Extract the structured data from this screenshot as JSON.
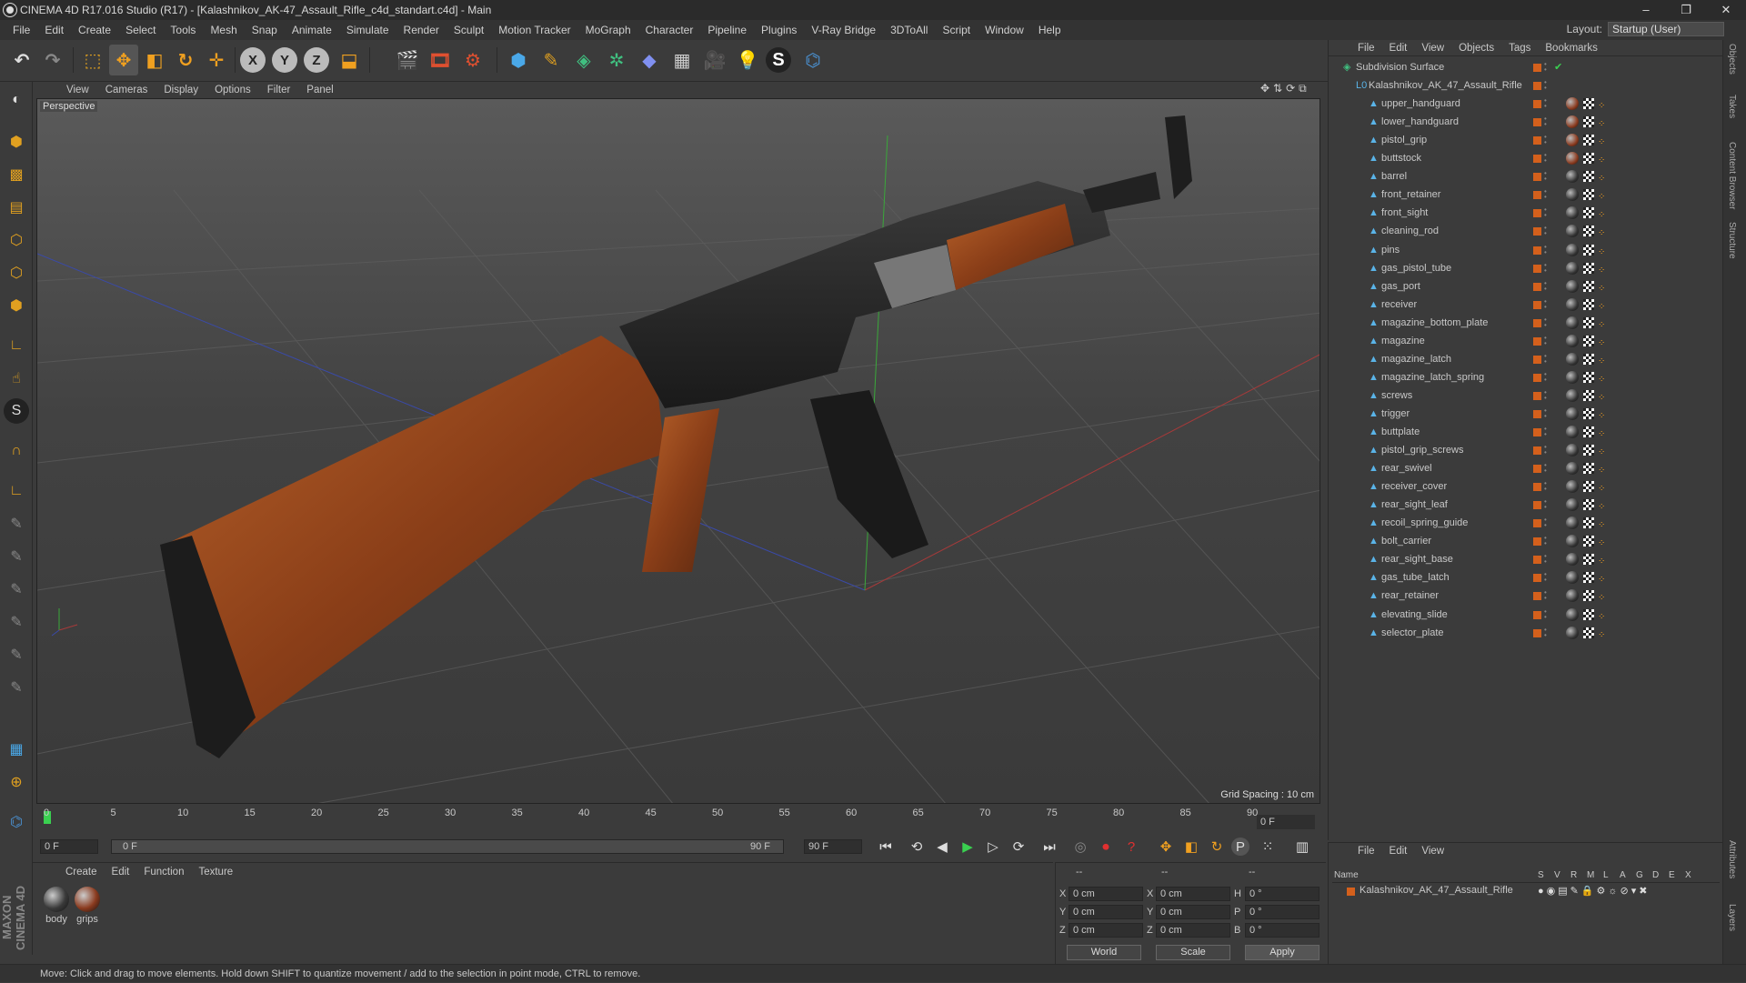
{
  "window": {
    "title": "CINEMA 4D R17.016 Studio (R17) - [Kalashnikov_AK-47_Assault_Rifle_c4d_standart.c4d] - Main",
    "minimize": "–",
    "maximize": "❐",
    "close": "✕"
  },
  "menu": [
    "File",
    "Edit",
    "Create",
    "Select",
    "Tools",
    "Mesh",
    "Snap",
    "Animate",
    "Simulate",
    "Render",
    "Sculpt",
    "Motion Tracker",
    "MoGraph",
    "Character",
    "Pipeline",
    "Plugins",
    "V-Ray Bridge",
    "3DToAll",
    "Script",
    "Window",
    "Help"
  ],
  "layout": {
    "label": "Layout:",
    "value": "Startup (User)"
  },
  "toolbar": {
    "x_label": "X",
    "y_label": "Y",
    "z_label": "Z"
  },
  "viewport": {
    "menu": [
      "View",
      "Cameras",
      "Display",
      "Options",
      "Filter",
      "Panel"
    ],
    "label": "Perspective",
    "grid_spacing": "Grid Spacing : 10 cm"
  },
  "timeline": {
    "ticks": [
      "0",
      "5",
      "10",
      "15",
      "20",
      "25",
      "30",
      "35",
      "40",
      "45",
      "50",
      "55",
      "60",
      "65",
      "70",
      "75",
      "80",
      "85",
      "90"
    ],
    "current_frame": "0 F"
  },
  "transport": {
    "start_field": "0 F",
    "range_start": "0 F",
    "range_end": "90 F",
    "end_field": "90 F"
  },
  "materials": {
    "menu": [
      "Create",
      "Edit",
      "Function",
      "Texture"
    ],
    "items": [
      {
        "name": "body",
        "color": "#3a3a3a"
      },
      {
        "name": "grips",
        "color": "#8a3a1e"
      }
    ]
  },
  "coords": {
    "header": [
      "--",
      "--",
      "--"
    ],
    "rows": [
      {
        "a": "X",
        "av": "0 cm",
        "b": "X",
        "bv": "0 cm",
        "c": "H",
        "cv": "0 °"
      },
      {
        "a": "Y",
        "av": "0 cm",
        "b": "Y",
        "bv": "0 cm",
        "c": "P",
        "cv": "0 °"
      },
      {
        "a": "Z",
        "av": "0 cm",
        "b": "Z",
        "bv": "0 cm",
        "c": "B",
        "cv": "0 °"
      }
    ],
    "world": "World",
    "scale": "Scale",
    "apply": "Apply"
  },
  "objects": {
    "menu": [
      "File",
      "Edit",
      "View",
      "Objects",
      "Tags",
      "Bookmarks"
    ],
    "root": "Subdivision Surface",
    "group": "Kalashnikov_AK_47_Assault_Rifle",
    "items": [
      "upper_handguard",
      "lower_handguard",
      "pistol_grip",
      "buttstock",
      "barrel",
      "front_retainer",
      "front_sight",
      "cleaning_rod",
      "pins",
      "gas_pistol_tube",
      "gas_port",
      "receiver",
      "magazine_bottom_plate",
      "magazine",
      "magazine_latch",
      "magazine_latch_spring",
      "screws",
      "trigger",
      "buttplate",
      "pistol_grip_screws",
      "rear_swivel",
      "receiver_cover",
      "rear_sight_leaf",
      "recoil_spring_guide",
      "bolt_carrier",
      "rear_sight_base",
      "gas_tube_latch",
      "rear_retainer",
      "elevating_slide",
      "selector_plate"
    ],
    "wood_items": [
      "upper_handguard",
      "lower_handguard",
      "pistol_grip",
      "buttstock"
    ]
  },
  "attributes": {
    "menu": [
      "File",
      "Edit",
      "View"
    ],
    "columns": [
      "Name",
      "S",
      "V",
      "R",
      "M",
      "L",
      "A",
      "G",
      "D",
      "E",
      "X"
    ],
    "row": "Kalashnikov_AK_47_Assault_Rifle"
  },
  "right_tabs": [
    "Objects",
    "Takes",
    "Content Browser",
    "Structure",
    "Attributes",
    "Layers"
  ],
  "status": "Move: Click and drag to move elements. Hold down SHIFT to quantize movement / add to the selection in point mode, CTRL to remove.",
  "brand": "MAXON CINEMA 4D"
}
